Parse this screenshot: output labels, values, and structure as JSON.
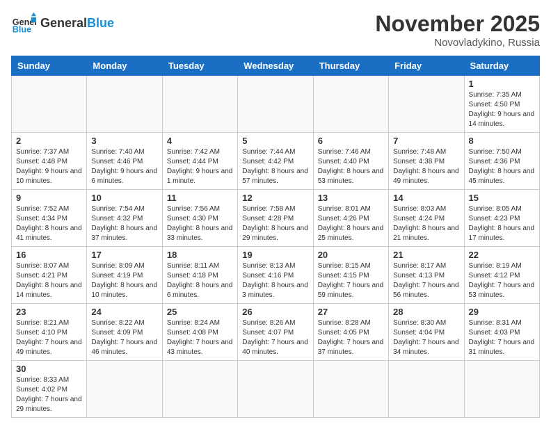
{
  "header": {
    "logo_general": "General",
    "logo_blue": "Blue",
    "month_title": "November 2025",
    "subtitle": "Novovladykino, Russia"
  },
  "days_of_week": [
    "Sunday",
    "Monday",
    "Tuesday",
    "Wednesday",
    "Thursday",
    "Friday",
    "Saturday"
  ],
  "weeks": [
    [
      {
        "day": "",
        "info": ""
      },
      {
        "day": "",
        "info": ""
      },
      {
        "day": "",
        "info": ""
      },
      {
        "day": "",
        "info": ""
      },
      {
        "day": "",
        "info": ""
      },
      {
        "day": "",
        "info": ""
      },
      {
        "day": "1",
        "info": "Sunrise: 7:35 AM\nSunset: 4:50 PM\nDaylight: 9 hours\nand 14 minutes."
      }
    ],
    [
      {
        "day": "2",
        "info": "Sunrise: 7:37 AM\nSunset: 4:48 PM\nDaylight: 9 hours\nand 10 minutes."
      },
      {
        "day": "3",
        "info": "Sunrise: 7:40 AM\nSunset: 4:46 PM\nDaylight: 9 hours\nand 6 minutes."
      },
      {
        "day": "4",
        "info": "Sunrise: 7:42 AM\nSunset: 4:44 PM\nDaylight: 9 hours\nand 1 minute."
      },
      {
        "day": "5",
        "info": "Sunrise: 7:44 AM\nSunset: 4:42 PM\nDaylight: 8 hours\nand 57 minutes."
      },
      {
        "day": "6",
        "info": "Sunrise: 7:46 AM\nSunset: 4:40 PM\nDaylight: 8 hours\nand 53 minutes."
      },
      {
        "day": "7",
        "info": "Sunrise: 7:48 AM\nSunset: 4:38 PM\nDaylight: 8 hours\nand 49 minutes."
      },
      {
        "day": "8",
        "info": "Sunrise: 7:50 AM\nSunset: 4:36 PM\nDaylight: 8 hours\nand 45 minutes."
      }
    ],
    [
      {
        "day": "9",
        "info": "Sunrise: 7:52 AM\nSunset: 4:34 PM\nDaylight: 8 hours\nand 41 minutes."
      },
      {
        "day": "10",
        "info": "Sunrise: 7:54 AM\nSunset: 4:32 PM\nDaylight: 8 hours\nand 37 minutes."
      },
      {
        "day": "11",
        "info": "Sunrise: 7:56 AM\nSunset: 4:30 PM\nDaylight: 8 hours\nand 33 minutes."
      },
      {
        "day": "12",
        "info": "Sunrise: 7:58 AM\nSunset: 4:28 PM\nDaylight: 8 hours\nand 29 minutes."
      },
      {
        "day": "13",
        "info": "Sunrise: 8:01 AM\nSunset: 4:26 PM\nDaylight: 8 hours\nand 25 minutes."
      },
      {
        "day": "14",
        "info": "Sunrise: 8:03 AM\nSunset: 4:24 PM\nDaylight: 8 hours\nand 21 minutes."
      },
      {
        "day": "15",
        "info": "Sunrise: 8:05 AM\nSunset: 4:23 PM\nDaylight: 8 hours\nand 17 minutes."
      }
    ],
    [
      {
        "day": "16",
        "info": "Sunrise: 8:07 AM\nSunset: 4:21 PM\nDaylight: 8 hours\nand 14 minutes."
      },
      {
        "day": "17",
        "info": "Sunrise: 8:09 AM\nSunset: 4:19 PM\nDaylight: 8 hours\nand 10 minutes."
      },
      {
        "day": "18",
        "info": "Sunrise: 8:11 AM\nSunset: 4:18 PM\nDaylight: 8 hours\nand 6 minutes."
      },
      {
        "day": "19",
        "info": "Sunrise: 8:13 AM\nSunset: 4:16 PM\nDaylight: 8 hours\nand 3 minutes."
      },
      {
        "day": "20",
        "info": "Sunrise: 8:15 AM\nSunset: 4:15 PM\nDaylight: 7 hours\nand 59 minutes."
      },
      {
        "day": "21",
        "info": "Sunrise: 8:17 AM\nSunset: 4:13 PM\nDaylight: 7 hours\nand 56 minutes."
      },
      {
        "day": "22",
        "info": "Sunrise: 8:19 AM\nSunset: 4:12 PM\nDaylight: 7 hours\nand 53 minutes."
      }
    ],
    [
      {
        "day": "23",
        "info": "Sunrise: 8:21 AM\nSunset: 4:10 PM\nDaylight: 7 hours\nand 49 minutes."
      },
      {
        "day": "24",
        "info": "Sunrise: 8:22 AM\nSunset: 4:09 PM\nDaylight: 7 hours\nand 46 minutes."
      },
      {
        "day": "25",
        "info": "Sunrise: 8:24 AM\nSunset: 4:08 PM\nDaylight: 7 hours\nand 43 minutes."
      },
      {
        "day": "26",
        "info": "Sunrise: 8:26 AM\nSunset: 4:07 PM\nDaylight: 7 hours\nand 40 minutes."
      },
      {
        "day": "27",
        "info": "Sunrise: 8:28 AM\nSunset: 4:05 PM\nDaylight: 7 hours\nand 37 minutes."
      },
      {
        "day": "28",
        "info": "Sunrise: 8:30 AM\nSunset: 4:04 PM\nDaylight: 7 hours\nand 34 minutes."
      },
      {
        "day": "29",
        "info": "Sunrise: 8:31 AM\nSunset: 4:03 PM\nDaylight: 7 hours\nand 31 minutes."
      }
    ],
    [
      {
        "day": "30",
        "info": "Sunrise: 8:33 AM\nSunset: 4:02 PM\nDaylight: 7 hours\nand 29 minutes."
      },
      {
        "day": "",
        "info": ""
      },
      {
        "day": "",
        "info": ""
      },
      {
        "day": "",
        "info": ""
      },
      {
        "day": "",
        "info": ""
      },
      {
        "day": "",
        "info": ""
      },
      {
        "day": "",
        "info": ""
      }
    ]
  ]
}
